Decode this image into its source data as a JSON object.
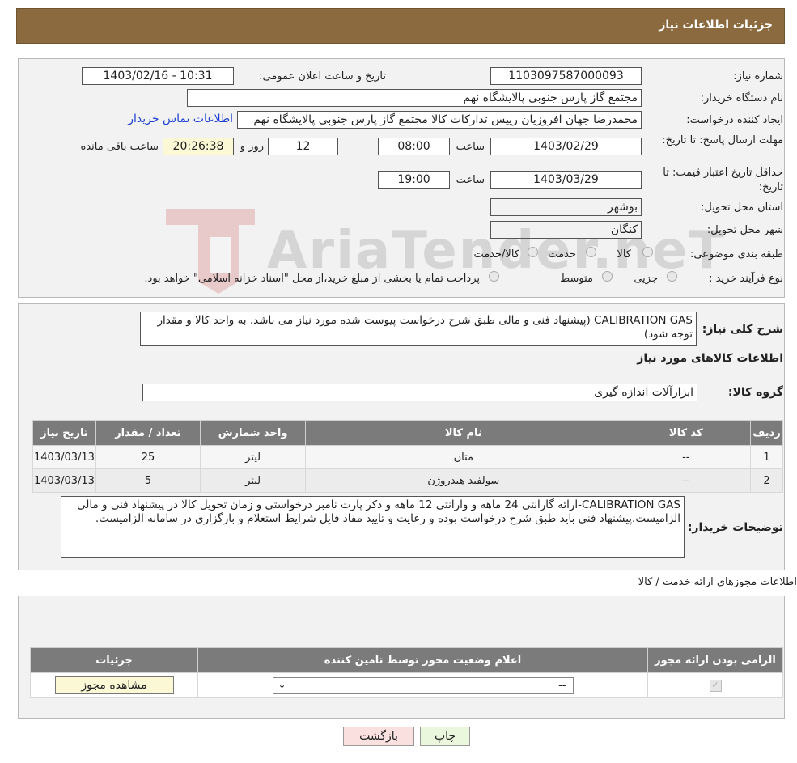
{
  "header": {
    "title": "جزئیات اطلاعات نیاز"
  },
  "fields": {
    "need_number_label": "شماره نیاز:",
    "need_number": "1103097587000093",
    "announce_label": "تاریخ و ساعت اعلان عمومی:",
    "announce_value": "1403/02/16 - 10:31",
    "buyer_org_label": "نام دستگاه خریدار:",
    "buyer_org": "مجتمع گاز پارس جنوبی  پالایشگاه نهم",
    "creator_label": "ایجاد کننده درخواست:",
    "creator": "محمدرضا جهان افروزیان رییس تدارکات کالا مجتمع گاز پارس جنوبی  پالایشگاه نهم",
    "contact_link": "اطلاعات تماس خریدار",
    "deadline_label": "مهلت ارسال پاسخ: تا تاریخ:",
    "deadline_date": "1403/02/29",
    "time_label": "ساعت",
    "deadline_time": "08:00",
    "days_value": "12",
    "days_label": "روز و",
    "remaining_time": "20:26:38",
    "remaining_label": "ساعت باقی مانده",
    "validity_label": "حداقل تاریخ اعتبار قیمت: تا تاریخ:",
    "validity_date": "1403/03/29",
    "validity_time": "19:00",
    "province_label": "استان محل تحویل:",
    "province": "بوشهر",
    "city_label": "شهر محل تحویل:",
    "city": "کنگان",
    "category_label": "طبقه بندی موضوعی:",
    "category_options": [
      "کالا",
      "خدمت",
      "کالا/خدمت"
    ],
    "process_label": "نوع فرآیند خرید :",
    "process_options": [
      "جزیی",
      "متوسط"
    ],
    "process_note": "پرداخت تمام یا بخشی از مبلغ خرید،از محل \"اسناد خزانه اسلامی\" خواهد بود."
  },
  "description": {
    "label": "شرح کلی نیاز:",
    "text": "CALIBRATION GAS (پیشنهاد فنی و مالی طبق شرح درخواست پیوست شده مورد نیاز می باشد. به واحد کالا و مقدار توجه شود)"
  },
  "goods": {
    "section_title": "اطلاعات کالاهای مورد نیاز",
    "group_label": "گروه کالا:",
    "group_value": "ابزارآلات اندازه گیری",
    "columns": [
      "ردیف",
      "کد کالا",
      "نام کالا",
      "واحد شمارش",
      "تعداد / مقدار",
      "تاریخ نیاز"
    ],
    "rows": [
      [
        "1",
        "--",
        "متان",
        "لیتر",
        "25",
        "1403/03/13"
      ],
      [
        "2",
        "--",
        "سولفید هیدروژن",
        "لیتر",
        "5",
        "1403/03/13"
      ]
    ]
  },
  "buyer_notes": {
    "label": "توضیحات خریدار:",
    "text": "CALIBRATION GAS-ارائه گارانتی 24 ماهه و وارانتی 12 ماهه و ذکر پارت نامبر درخواستی و زمان تحویل کالا در پیشنهاد فنی و مالی الزامیست.پیشنهاد فنی باید طبق شرح درخواست بوده و رعایت و تایید مفاد فایل شرایط استعلام و بارگزاری در سامانه الزامیست."
  },
  "permits": {
    "section_title": "اطلاعات مجوزهای ارائه خدمت / کالا",
    "columns": [
      "الزامی بودن ارائه مجوز",
      "اعلام وضعیت مجوز توسط تامین کننده",
      "جزئیات"
    ],
    "select_value": "--",
    "view_button": "مشاهده مجوز"
  },
  "footer": {
    "print_button": "چاپ",
    "back_button": "بازگشت"
  },
  "watermark": {
    "text": "AriaTender.neT"
  },
  "colors": {
    "header_bg": "#8b6a3f",
    "table_header_bg": "#7b7b7b",
    "link": "#1a3fd0"
  }
}
